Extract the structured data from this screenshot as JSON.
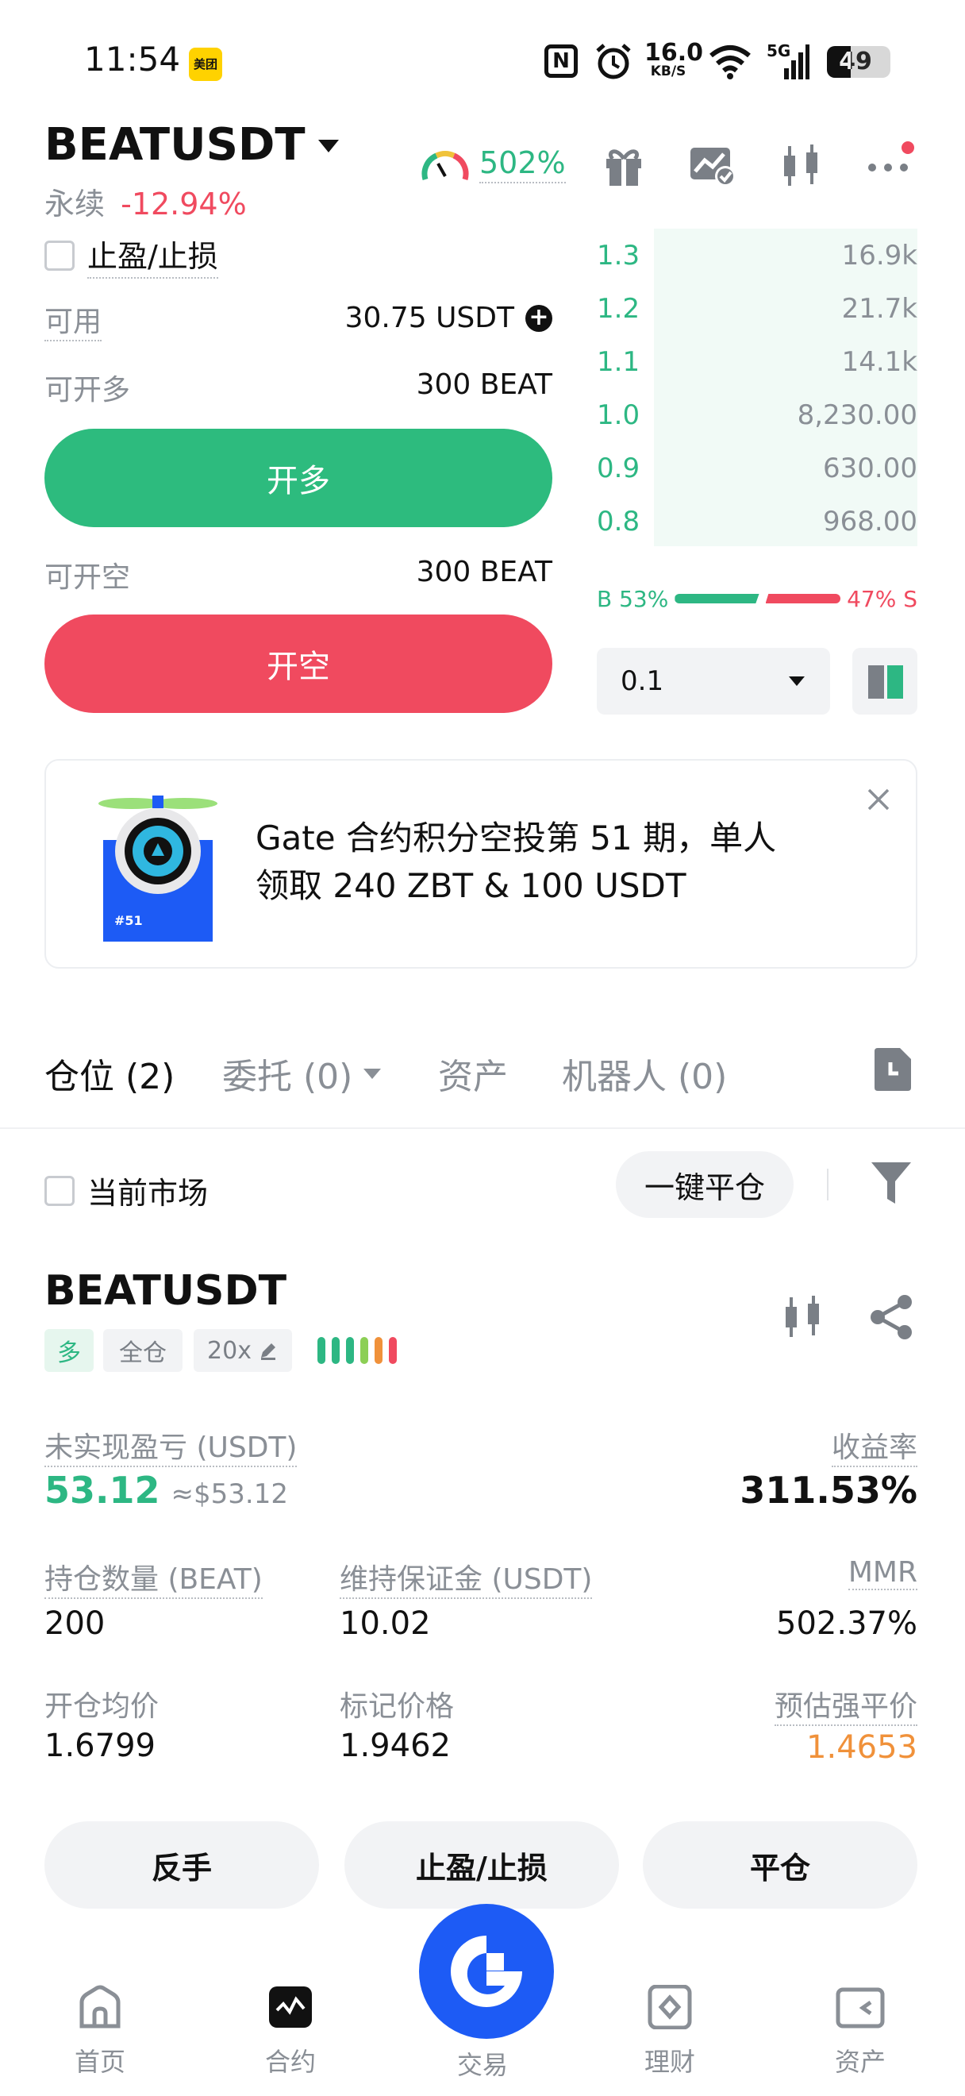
{
  "status_bar": {
    "time": "11:54",
    "app_badge": "美团",
    "net_speed_value": "16.0",
    "net_speed_unit": "KB/S",
    "network": "5G",
    "battery": "49"
  },
  "header": {
    "pair": "BEATUSDT",
    "contract_type": "永续",
    "change": "-12.94%",
    "risk_value": "502%",
    "icons": [
      "gift-icon",
      "chart-check-icon",
      "candlestick-icon",
      "more-icon"
    ]
  },
  "order_form": {
    "tpsl_label": "止盈/止损",
    "available_label": "可用",
    "available_value": "30.75 USDT",
    "can_long_label": "可开多",
    "can_long_value": "300 BEAT",
    "long_button": "开多",
    "can_short_label": "可开空",
    "can_short_value": "300 BEAT",
    "short_button": "开空"
  },
  "orderbook": {
    "rows": [
      {
        "price": "1.3",
        "qty": "16.9k",
        "depth": 0.96
      },
      {
        "price": "1.2",
        "qty": "21.7k",
        "depth": 0.96
      },
      {
        "price": "1.1",
        "qty": "14.1k",
        "depth": 0.96
      },
      {
        "price": "1.0",
        "qty": "8,230.00",
        "depth": 0.96
      },
      {
        "price": "0.9",
        "qty": "630.00",
        "depth": 0.96
      },
      {
        "price": "0.8",
        "qty": "968.00",
        "depth": 0.96
      }
    ],
    "buy_label": "B 53%",
    "sell_label": "47% S",
    "buy_ratio": 0.53,
    "precision_value": "0.1"
  },
  "banner": {
    "text_line1": "Gate 合约积分空投第 51 期，单人",
    "text_line2": "领取 240 ZBT & 100 USDT",
    "image_caption": "#51"
  },
  "tabs": {
    "positions": "仓位 (2)",
    "orders": "委托 (0)",
    "assets": "资产",
    "bots": "机器人 (0)"
  },
  "filters": {
    "current_market_label": "当前市场",
    "close_all_button": "一键平仓"
  },
  "position": {
    "symbol": "BEATUSDT",
    "side_tag": "多",
    "margin_tag": "全仓",
    "leverage_tag": "20x",
    "unrealized_label": "未实现盈亏 (USDT)",
    "unrealized_value": "53.12",
    "unrealized_usd": "≈$53.12",
    "roi_label": "收益率",
    "roi_value": "311.53%",
    "size_label": "持仓数量 (BEAT)",
    "size_value": "200",
    "maint_margin_label": "维持保证金 (USDT)",
    "maint_margin_value": "10.02",
    "mmr_label": "MMR",
    "mmr_value": "502.37%",
    "entry_label": "开仓均价",
    "entry_value": "1.6799",
    "mark_label": "标记价格",
    "mark_value": "1.9462",
    "liq_label": "预估强平价",
    "liq_value": "1.4653",
    "reverse_button": "反手",
    "tpsl_button": "止盈/止损",
    "close_button": "平仓"
  },
  "bottom_nav": {
    "home": "首页",
    "futures": "合约",
    "trade": "交易",
    "finance": "理财",
    "assets": "资产"
  },
  "colors": {
    "green": "#2db783",
    "red": "#f04a5f",
    "orange": "#f0913a",
    "brand_blue": "#1d5bf5"
  }
}
